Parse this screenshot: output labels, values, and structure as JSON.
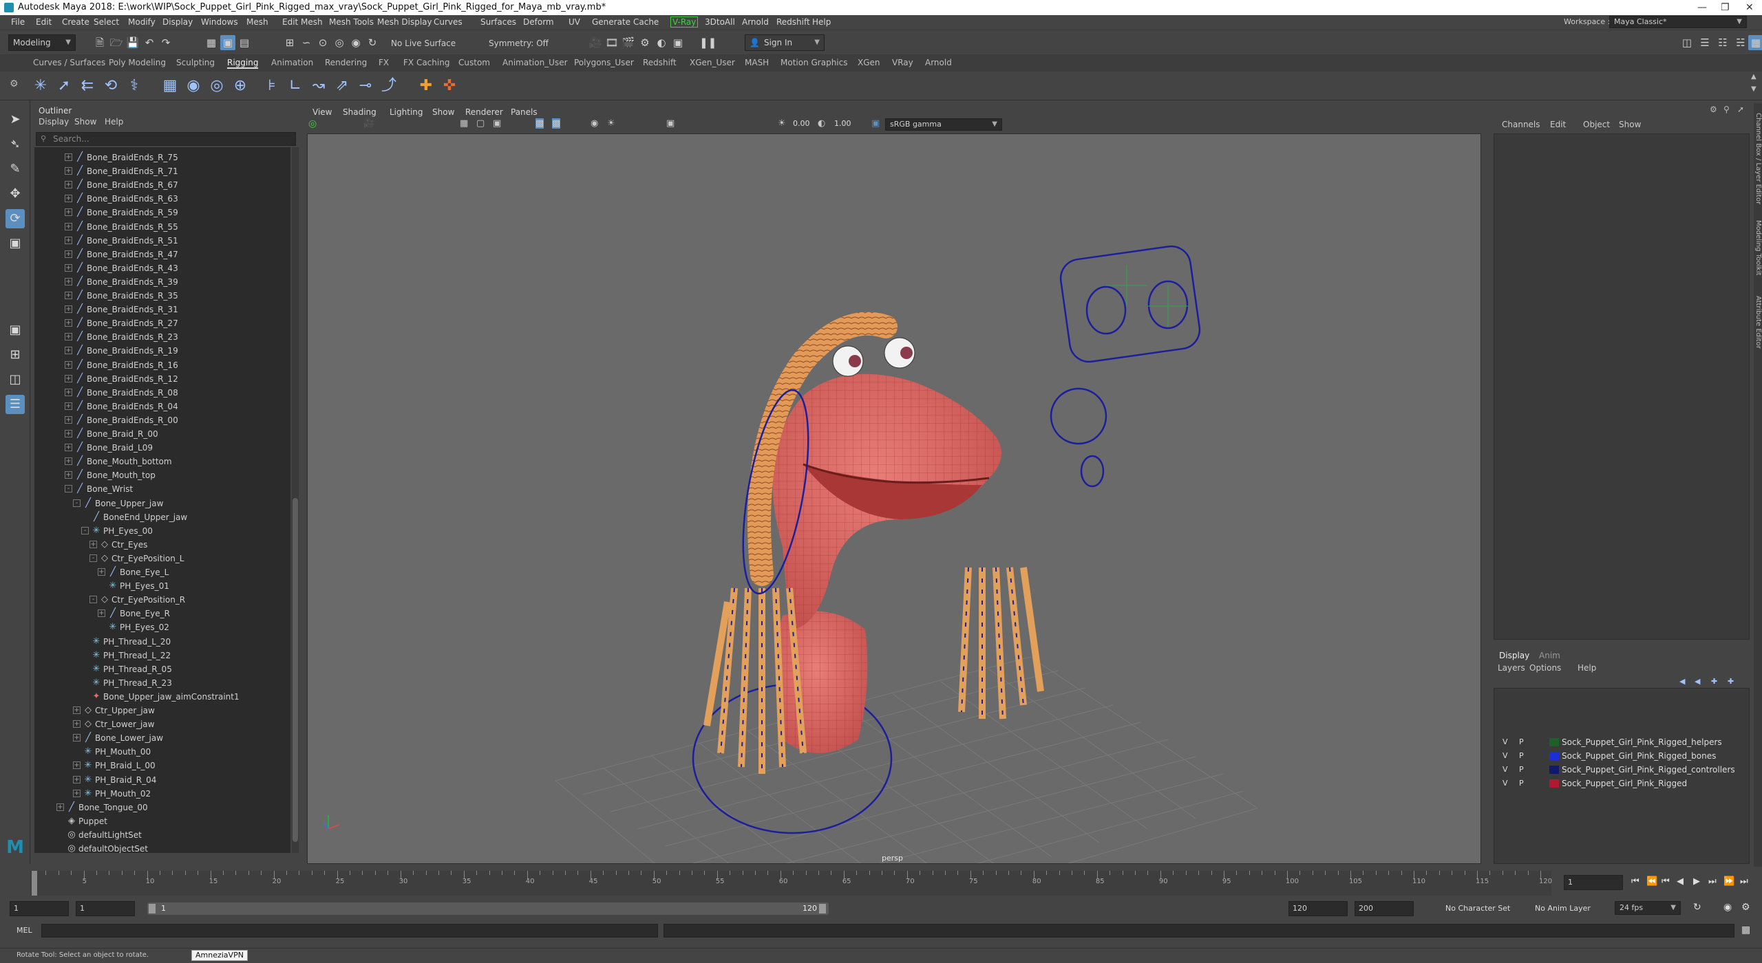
{
  "window": {
    "title": "Autodesk Maya 2018: E:\\work\\WIP\\Sock_Puppet_Girl_Pink_Rigged_max_vray\\Sock_Puppet_Girl_Pink_Rigged_for_Maya_mb_vray.mb*"
  },
  "menubar": {
    "items": [
      "File",
      "Edit",
      "Create",
      "Select",
      "Modify",
      "Display",
      "Windows",
      "Mesh",
      "Edit Mesh",
      "Mesh Tools",
      "Mesh Display",
      "Curves",
      "Surfaces",
      "Deform",
      "UV",
      "Generate",
      "Cache",
      "V-Ray",
      "3DtoAll",
      "Arnold",
      "Redshift",
      "Help"
    ],
    "workspace_label": "Workspace :",
    "workspace_value": "Maya Classic*"
  },
  "statusline": {
    "mode": "Modeling",
    "live_surface": "No Live Surface",
    "symmetry": "Symmetry: Off",
    "sign_in": "Sign In"
  },
  "shelf": {
    "tabs": [
      "Curves / Surfaces",
      "Poly Modeling",
      "Sculpting",
      "Rigging",
      "Animation",
      "Rendering",
      "FX",
      "FX Caching",
      "Custom",
      "Animation_User",
      "Polygons_User",
      "Redshift",
      "XGen_User",
      "MASH",
      "Motion Graphics",
      "XGen",
      "VRay",
      "Arnold"
    ],
    "active_tab": "Rigging"
  },
  "outliner": {
    "title": "Outliner",
    "menus": [
      "Display",
      "Show",
      "Help"
    ],
    "search_placeholder": "Search...",
    "rows": [
      {
        "label": "Bone_BraidEnds_R_75",
        "indent": 0,
        "kind": "bone",
        "expand": "+"
      },
      {
        "label": "Bone_BraidEnds_R_71",
        "indent": 0,
        "kind": "bone",
        "expand": "+"
      },
      {
        "label": "Bone_BraidEnds_R_67",
        "indent": 0,
        "kind": "bone",
        "expand": "+"
      },
      {
        "label": "Bone_BraidEnds_R_63",
        "indent": 0,
        "kind": "bone",
        "expand": "+"
      },
      {
        "label": "Bone_BraidEnds_R_59",
        "indent": 0,
        "kind": "bone",
        "expand": "+"
      },
      {
        "label": "Bone_BraidEnds_R_55",
        "indent": 0,
        "kind": "bone",
        "expand": "+"
      },
      {
        "label": "Bone_BraidEnds_R_51",
        "indent": 0,
        "kind": "bone",
        "expand": "+"
      },
      {
        "label": "Bone_BraidEnds_R_47",
        "indent": 0,
        "kind": "bone",
        "expand": "+"
      },
      {
        "label": "Bone_BraidEnds_R_43",
        "indent": 0,
        "kind": "bone",
        "expand": "+"
      },
      {
        "label": "Bone_BraidEnds_R_39",
        "indent": 0,
        "kind": "bone",
        "expand": "+"
      },
      {
        "label": "Bone_BraidEnds_R_35",
        "indent": 0,
        "kind": "bone",
        "expand": "+"
      },
      {
        "label": "Bone_BraidEnds_R_31",
        "indent": 0,
        "kind": "bone",
        "expand": "+"
      },
      {
        "label": "Bone_BraidEnds_R_27",
        "indent": 0,
        "kind": "bone",
        "expand": "+"
      },
      {
        "label": "Bone_BraidEnds_R_23",
        "indent": 0,
        "kind": "bone",
        "expand": "+"
      },
      {
        "label": "Bone_BraidEnds_R_19",
        "indent": 0,
        "kind": "bone",
        "expand": "+"
      },
      {
        "label": "Bone_BraidEnds_R_16",
        "indent": 0,
        "kind": "bone",
        "expand": "+"
      },
      {
        "label": "Bone_BraidEnds_R_12",
        "indent": 0,
        "kind": "bone",
        "expand": "+"
      },
      {
        "label": "Bone_BraidEnds_R_08",
        "indent": 0,
        "kind": "bone",
        "expand": "+"
      },
      {
        "label": "Bone_BraidEnds_R_04",
        "indent": 0,
        "kind": "bone",
        "expand": "+"
      },
      {
        "label": "Bone_BraidEnds_R_00",
        "indent": 0,
        "kind": "bone",
        "expand": "+"
      },
      {
        "label": "Bone_Braid_R_00",
        "indent": 0,
        "kind": "bone",
        "expand": "+"
      },
      {
        "label": "Bone_Braid_L09",
        "indent": 0,
        "kind": "bone",
        "expand": "+"
      },
      {
        "label": "Bone_Mouth_bottom",
        "indent": 0,
        "kind": "bone",
        "expand": "+"
      },
      {
        "label": "Bone_Mouth_top",
        "indent": 0,
        "kind": "bone",
        "expand": "+"
      },
      {
        "label": "Bone_Wrist",
        "indent": 0,
        "kind": "bone",
        "expand": "-"
      },
      {
        "label": "Bone_Upper_jaw",
        "indent": 1,
        "kind": "bone",
        "expand": "-"
      },
      {
        "label": "BoneEnd_Upper_jaw",
        "indent": 2,
        "kind": "bone",
        "expand": ""
      },
      {
        "label": "PH_Eyes_00",
        "indent": 2,
        "kind": "locator",
        "expand": "-"
      },
      {
        "label": "Ctr_Eyes",
        "indent": 3,
        "kind": "ctrl",
        "expand": "+"
      },
      {
        "label": "Ctr_EyePosition_L",
        "indent": 3,
        "kind": "ctrl",
        "expand": "-"
      },
      {
        "label": "Bone_Eye_L",
        "indent": 4,
        "kind": "bone",
        "expand": "+"
      },
      {
        "label": "PH_Eyes_01",
        "indent": 4,
        "kind": "locator",
        "expand": ""
      },
      {
        "label": "Ctr_EyePosition_R",
        "indent": 3,
        "kind": "ctrl",
        "expand": "-"
      },
      {
        "label": "Bone_Eye_R",
        "indent": 4,
        "kind": "bone",
        "expand": "+"
      },
      {
        "label": "PH_Eyes_02",
        "indent": 4,
        "kind": "locator",
        "expand": ""
      },
      {
        "label": "PH_Thread_L_20",
        "indent": 2,
        "kind": "locator",
        "expand": ""
      },
      {
        "label": "PH_Thread_L_22",
        "indent": 2,
        "kind": "locator",
        "expand": ""
      },
      {
        "label": "PH_Thread_R_05",
        "indent": 2,
        "kind": "locator",
        "expand": ""
      },
      {
        "label": "PH_Thread_R_23",
        "indent": 2,
        "kind": "locator",
        "expand": ""
      },
      {
        "label": "Bone_Upper_jaw_aimConstraint1",
        "indent": 2,
        "kind": "constraint",
        "expand": ""
      },
      {
        "label": "Ctr_Upper_jaw",
        "indent": 1,
        "kind": "ctrl",
        "expand": "+"
      },
      {
        "label": "Ctr_Lower_jaw",
        "indent": 1,
        "kind": "ctrl",
        "expand": "+"
      },
      {
        "label": "Bone_Lower_jaw",
        "indent": 1,
        "kind": "bone",
        "expand": "+"
      },
      {
        "label": "PH_Mouth_00",
        "indent": 1,
        "kind": "locator",
        "expand": ""
      },
      {
        "label": "PH_Braid_L_00",
        "indent": 1,
        "kind": "locator",
        "expand": "+"
      },
      {
        "label": "PH_Braid_R_04",
        "indent": 1,
        "kind": "locator",
        "expand": "+"
      },
      {
        "label": "PH_Mouth_02",
        "indent": 1,
        "kind": "locator",
        "expand": "+"
      },
      {
        "label": "Bone_Tongue_00",
        "indent": -1,
        "kind": "bone",
        "expand": "+"
      },
      {
        "label": "Puppet",
        "indent": -1,
        "kind": "mesh",
        "expand": ""
      },
      {
        "label": "defaultLightSet",
        "indent": -1,
        "kind": "set",
        "expand": ""
      },
      {
        "label": "defaultObjectSet",
        "indent": -1,
        "kind": "set",
        "expand": ""
      }
    ]
  },
  "viewport": {
    "menus": [
      "View",
      "Shading",
      "Lighting",
      "Show",
      "Renderer",
      "Panels"
    ],
    "exposure": "0.00",
    "gamma": "1.00",
    "color_space": "sRGB gamma",
    "camera_label": "persp"
  },
  "channelbox": {
    "menus": [
      "Channels",
      "Edit",
      "Object",
      "Show"
    ],
    "layer_tabs": [
      "Display",
      "Anim"
    ],
    "layer_menus": [
      "Layers",
      "Options",
      "Help"
    ],
    "layers": [
      {
        "v": "V",
        "p": "P",
        "name": "Sock_Puppet_Girl_Pink_Rigged_helpers",
        "color": "#1f5f2a"
      },
      {
        "v": "V",
        "p": "P",
        "name": "Sock_Puppet_Girl_Pink_Rigged_bones",
        "color": "#1a2fd8"
      },
      {
        "v": "V",
        "p": "P",
        "name": "Sock_Puppet_Girl_Pink_Rigged_controllers",
        "color": "#0f1a6a"
      },
      {
        "v": "V",
        "p": "P",
        "name": "Sock_Puppet_Girl_Pink_Rigged",
        "color": "#b0192f"
      }
    ],
    "side_tabs": [
      "Channel Box / Layer Editor",
      "Modeling Toolkit",
      "Attribute Editor"
    ]
  },
  "timeline": {
    "ticks": [
      "1",
      "5",
      "10",
      "15",
      "20",
      "25",
      "30",
      "35",
      "40",
      "45",
      "50",
      "55",
      "60",
      "65",
      "70",
      "75",
      "80",
      "85",
      "90",
      "95",
      "100",
      "105",
      "110",
      "115",
      "120"
    ],
    "current_frame": "1",
    "current_frame_field": "1"
  },
  "range": {
    "start": "1",
    "start_inner": "1",
    "slider_start": "1",
    "slider_end": "120",
    "end": "120",
    "max": "200",
    "character_set": "No Character Set",
    "anim_layer": "No Anim Layer",
    "fps": "24 fps"
  },
  "cmdline": {
    "label": "MEL"
  },
  "helpline": {
    "text": "Rotate Tool: Select an object to rotate.",
    "tooltip": "AmneziaVPN"
  },
  "colors": {
    "accent": "#5b8fbf",
    "vray": "#3ecf3e",
    "skin": "#d9605e",
    "rig": "#1c1f9c"
  }
}
